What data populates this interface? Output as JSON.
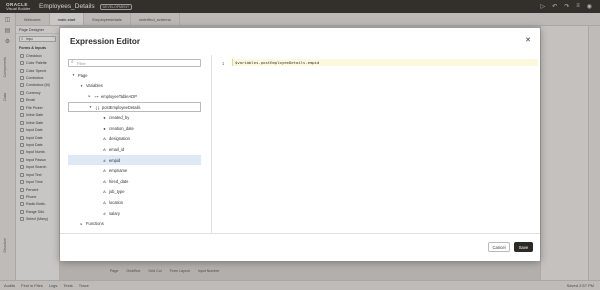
{
  "app": {
    "brand_top": "ORACLE",
    "brand_bottom": "Visual Builder",
    "title": "Employees_Details",
    "badge": "DEVELOPMENT"
  },
  "tabs": [
    "Welcome",
    "main-start",
    "Employeedetails",
    "orderfind_schema"
  ],
  "left_rail": {
    "components_label": "Components",
    "data_label": "Data",
    "structure_label": "Structure"
  },
  "palette": {
    "header": "Page Designer",
    "search_value": "inpu",
    "section": "Forms & Inputs",
    "items": [
      "Checkbox",
      "Color Palette",
      "Color Spectr.",
      "Combobox",
      "Combobox (M)",
      "Currency",
      "Email",
      "File Picker",
      "Inline Date",
      "Inline Date",
      "Input Date",
      "Input Date",
      "Input Date",
      "Input Numb.",
      "Input Passw.",
      "Input Search",
      "Input Text",
      "Input Time",
      "Percent",
      "Phone",
      "Radio Butto.",
      "Range Slid.",
      "Select (Many)"
    ]
  },
  "canvas_bar": [
    "Page",
    "Grid/Box",
    "Grid Col",
    "Form Layout",
    "Input Number"
  ],
  "status": {
    "items": [
      "Audits",
      "Find in Files",
      "Logs",
      "Tests",
      "Trace"
    ],
    "saved": "Saved 2:57 PM"
  },
  "dialog": {
    "title": "Expression Editor",
    "filter_placeholder": "Filter",
    "tree": [
      {
        "label": "Page",
        "toggle": "▾",
        "icon": "",
        "indent": 0
      },
      {
        "label": "Variables",
        "toggle": "▾",
        "icon": "",
        "indent": 1
      },
      {
        "label": "employeeTableADP",
        "toggle": "▸",
        "icon": "⊶",
        "indent": 2
      },
      {
        "label": "postEmployeeDetails",
        "toggle": "▾",
        "icon": "{ }",
        "indent": 2
      },
      {
        "label": "created_by",
        "toggle": "",
        "icon": "●",
        "indent": 3
      },
      {
        "label": "creation_date",
        "toggle": "",
        "icon": "●",
        "indent": 3
      },
      {
        "label": "designation",
        "toggle": "",
        "icon": "A",
        "indent": 3
      },
      {
        "label": "email_id",
        "toggle": "",
        "icon": "A",
        "indent": 3
      },
      {
        "label": "empid",
        "toggle": "",
        "icon": "#",
        "indent": 3
      },
      {
        "label": "empname",
        "toggle": "",
        "icon": "A",
        "indent": 3
      },
      {
        "label": "hired_date",
        "toggle": "",
        "icon": "A",
        "indent": 3
      },
      {
        "label": "job_type",
        "toggle": "",
        "icon": "A",
        "indent": 3
      },
      {
        "label": "location",
        "toggle": "",
        "icon": "A",
        "indent": 3
      },
      {
        "label": "salary",
        "toggle": "",
        "icon": "#",
        "indent": 3
      },
      {
        "label": "Functions",
        "toggle": "▸",
        "icon": "",
        "indent": 1
      }
    ],
    "line_number": "1",
    "expression": "$variables.postEmployeeDetails.empid",
    "cancel_label": "Cancel",
    "save_label": "Save"
  }
}
